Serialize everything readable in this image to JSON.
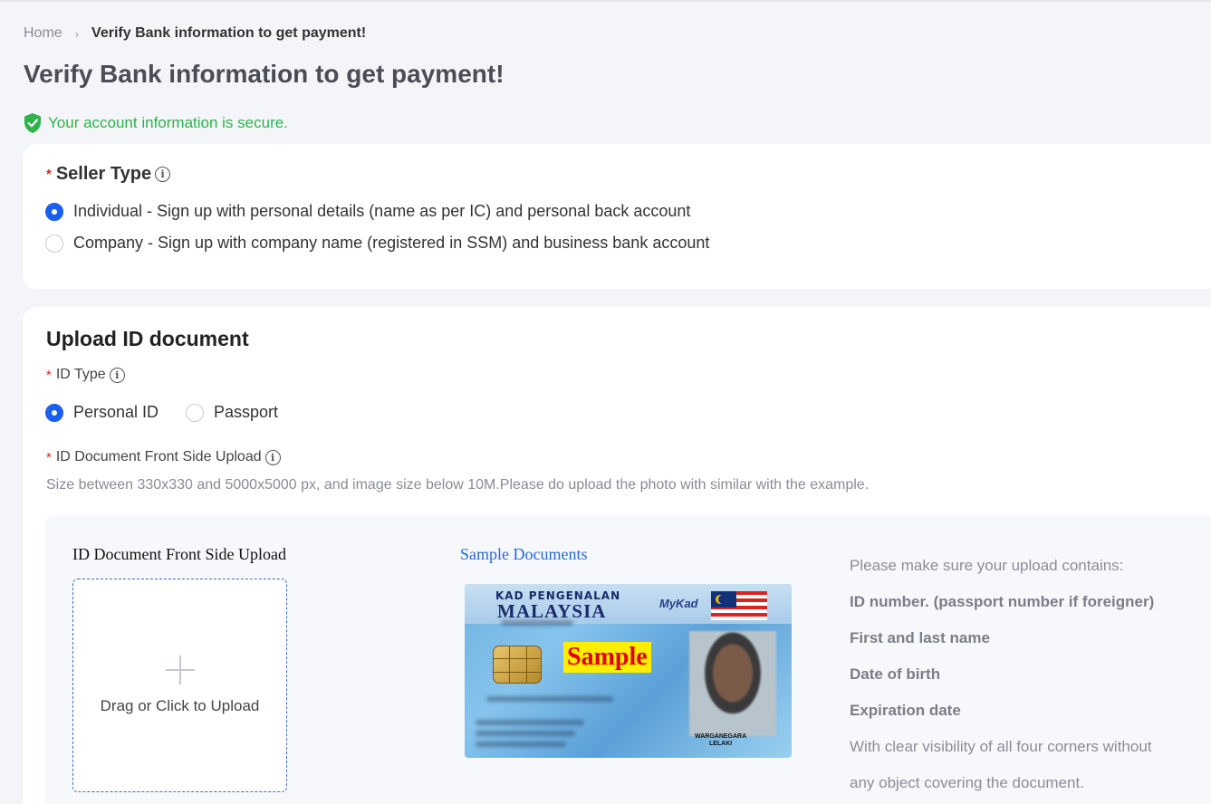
{
  "breadcrumb": {
    "home": "Home",
    "separator": "›",
    "current": "Verify Bank information to get payment!"
  },
  "page_title": "Verify Bank information to get payment!",
  "secure_text": "Your account information is secure.",
  "seller_type": {
    "required": "*",
    "label": "Seller Type",
    "options": [
      "Individual - Sign up with personal details (name as per IC) and personal back account",
      "Company - Sign up with company name (registered in SSM) and business bank account"
    ],
    "selected": 0
  },
  "upload": {
    "title": "Upload ID document",
    "id_type_label": "ID Type",
    "id_type_options": [
      "Personal ID",
      "Passport"
    ],
    "front_label": "ID Document Front Side Upload",
    "hint": "Size between 330x330 and 5000x5000 px, and image size below 10M.Please do upload the photo with similar with the example.",
    "area_title": "ID Document Front Side Upload",
    "dropzone_text": "Drag or Click to Upload",
    "sample_title": "Sample Documents",
    "sample_card": {
      "kad": "KAD PENGENALAN",
      "country": "MALAYSIA",
      "brand": "MyKad",
      "stamp": "Sample",
      "warga_1": "WARGANEGARA",
      "warga_2": "LELAKI"
    },
    "instructions": {
      "intro": "Please make sure your upload contains:",
      "items": [
        "ID number. (passport number if foreigner)",
        "First and last name",
        "Date of birth",
        "Expiration date"
      ],
      "outro_1": "With clear visibility of all four corners without",
      "outro_2": "any object covering the document."
    }
  },
  "colors": {
    "primary": "#1a5ff0",
    "secure_green": "#2db34a",
    "required_red": "#e02020",
    "link_blue": "#2667d9"
  }
}
